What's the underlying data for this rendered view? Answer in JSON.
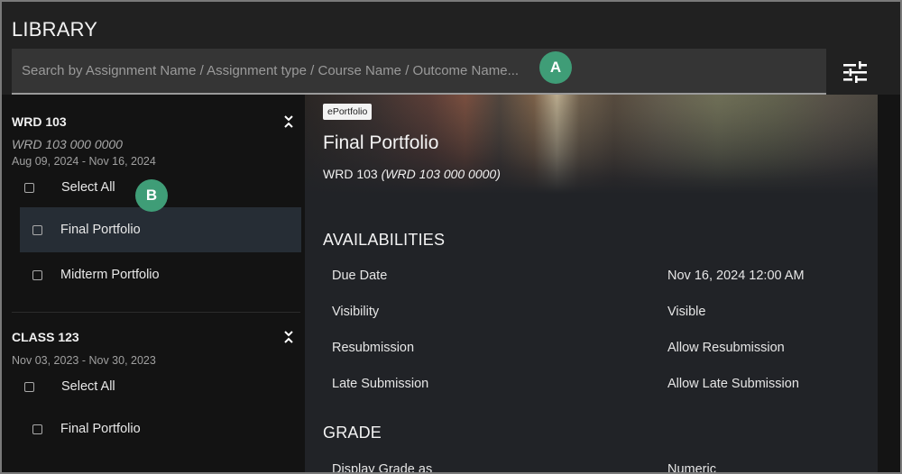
{
  "header": {
    "title": "LIBRARY",
    "search_placeholder": "Search by Assignment Name / Assignment type / Course Name / Outcome Name...",
    "search_value": "",
    "filter_icon": "sliders-icon"
  },
  "annotations": {
    "a": "A",
    "b": "B",
    "color": "#3f9d77"
  },
  "sidebar": {
    "courses": [
      {
        "name": "WRD 103",
        "code": "WRD 103 000 0000",
        "dates": "Aug 09, 2024 - Nov 16, 2024",
        "select_all_label": "Select All",
        "items": [
          {
            "label": "Final Portfolio",
            "selected": true
          },
          {
            "label": "Midterm Portfolio",
            "selected": false
          }
        ]
      },
      {
        "name": "CLASS 123",
        "dates": "Nov 03, 2023 - Nov 30, 2023",
        "select_all_label": "Select All",
        "items": [
          {
            "label": "Final Portfolio",
            "selected": false
          }
        ]
      }
    ]
  },
  "detail": {
    "type_tag": "ePortfolio",
    "title": "Final Portfolio",
    "course_name": "WRD 103",
    "course_code": "(WRD 103 000 0000)",
    "availabilities": {
      "heading": "AVAILABILITIES",
      "rows": [
        {
          "label": "Due Date",
          "value": "Nov 16, 2024 12:00 AM"
        },
        {
          "label": "Visibility",
          "value": "Visible"
        },
        {
          "label": "Resubmission",
          "value": "Allow Resubmission"
        },
        {
          "label": "Late Submission",
          "value": "Allow Late Submission"
        }
      ]
    },
    "grade": {
      "heading": "GRADE",
      "rows": [
        {
          "label": "Display Grade as",
          "value": "Numeric"
        }
      ]
    }
  }
}
